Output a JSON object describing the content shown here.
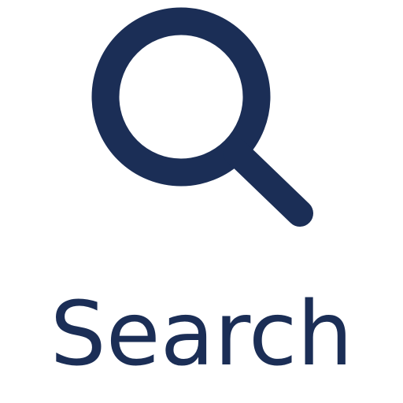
{
  "colors": {
    "accent": "#1B2E56",
    "background": "#FFFFFF"
  },
  "icon": {
    "name": "search-icon"
  },
  "label": {
    "text": "Search"
  }
}
